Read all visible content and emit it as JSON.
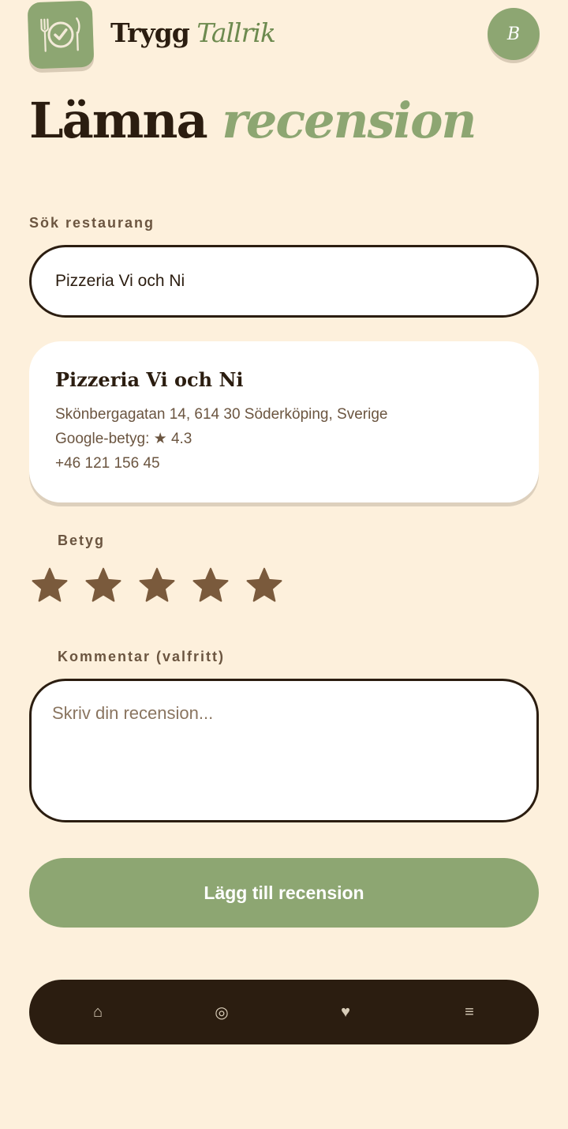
{
  "header": {
    "brand_part1": "Trygg",
    "brand_part2": "Tallrik",
    "avatar_initial": "B",
    "logo_icon": "plate-check-icon"
  },
  "page": {
    "title_part1": "Lämna",
    "title_part2": "recension"
  },
  "search": {
    "label": "Sök restaurang",
    "value": "Pizzeria Vi och Ni"
  },
  "restaurant": {
    "name": "Pizzeria Vi och Ni",
    "address": "Skönbergagatan 14, 614 30 Söderköping, Sverige",
    "rating_line": "Google-betyg: ★ 4.3",
    "phone": "+46 121 156 45"
  },
  "rating": {
    "label": "Betyg",
    "max": 5,
    "selected": 5
  },
  "comment": {
    "label": "Kommentar (valfritt)",
    "placeholder": "Skriv din recension..."
  },
  "submit": {
    "label": "Lägg till recension"
  },
  "nav": {
    "items": [
      {
        "icon": "home-icon",
        "glyph": "⌂"
      },
      {
        "icon": "target-icon",
        "glyph": "◎"
      },
      {
        "icon": "heart-icon",
        "glyph": "♥"
      },
      {
        "icon": "menu-icon",
        "glyph": "≡"
      }
    ]
  },
  "colors": {
    "background": "#fdf0dc",
    "accent": "#8da672",
    "dark": "#2b1d10",
    "star": "#7a5a3c"
  }
}
